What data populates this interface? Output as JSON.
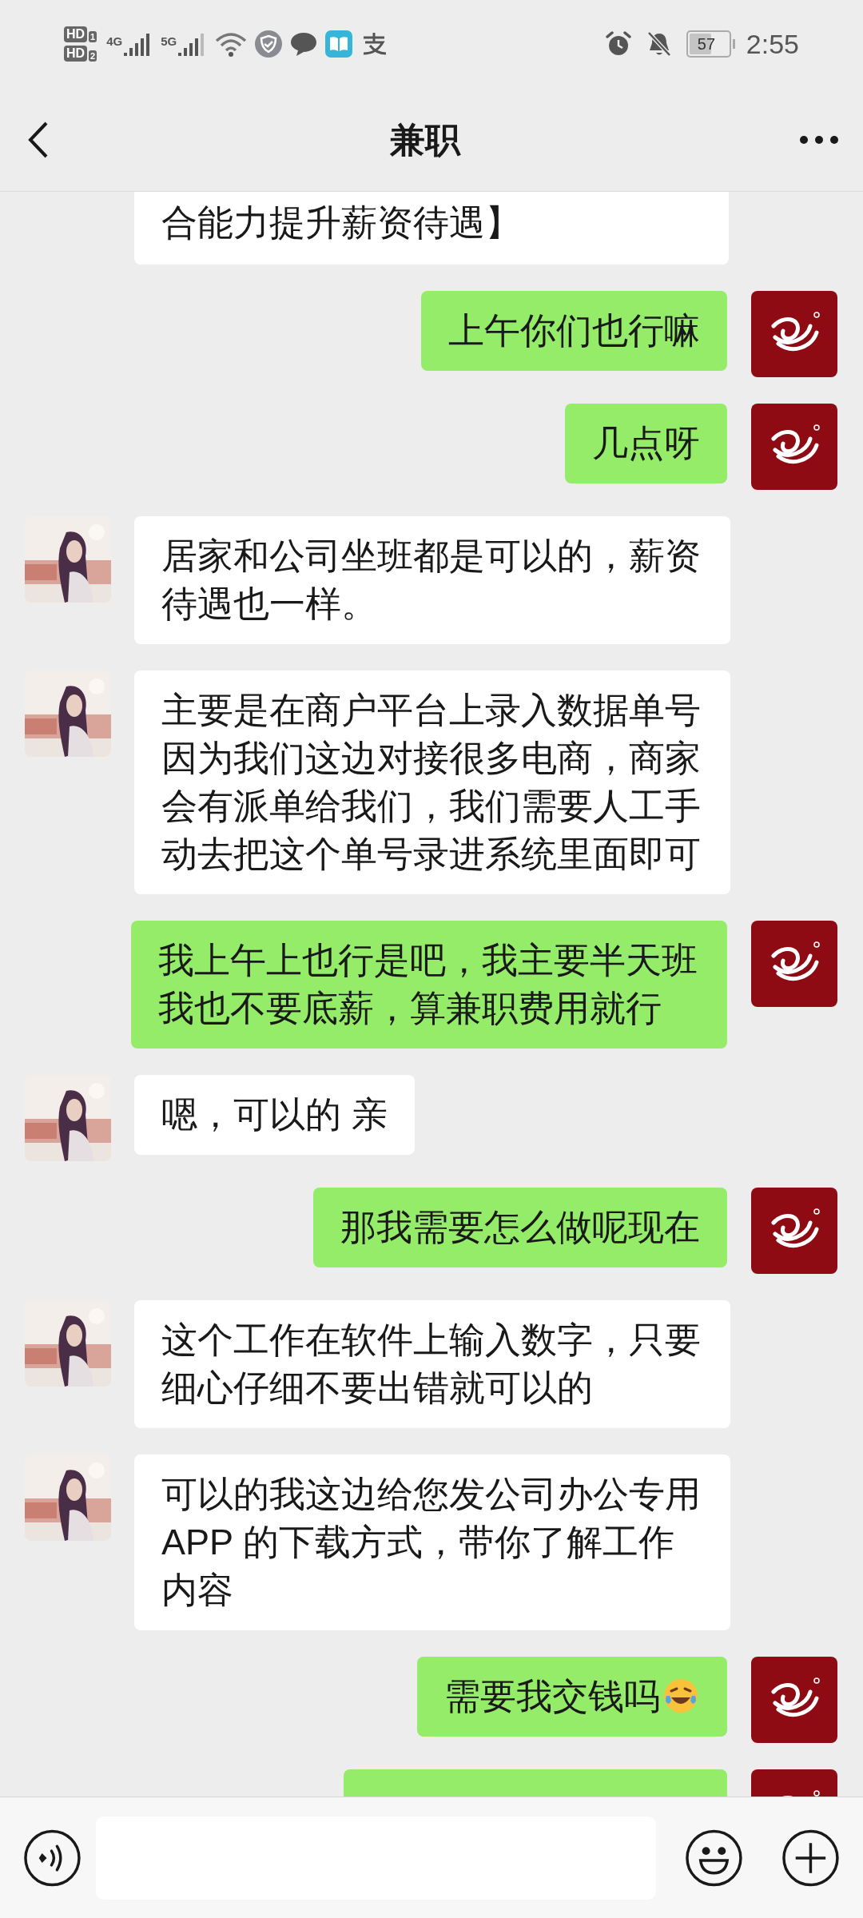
{
  "status_bar": {
    "hd_badges": [
      {
        "label": "HD",
        "slot": "1"
      },
      {
        "label": "HD",
        "slot": "2"
      }
    ],
    "networks": [
      "4G",
      "5G"
    ],
    "battery": "57",
    "time": "2:55"
  },
  "header": {
    "title": "兼职"
  },
  "messages": [
    {
      "outgoing": false,
      "kind": "top_cut",
      "text": "合能力提升薪资待遇】"
    },
    {
      "outgoing": true,
      "kind": "full",
      "text": "上午你们也行嘛"
    },
    {
      "outgoing": true,
      "kind": "full",
      "text": "几点呀"
    },
    {
      "outgoing": false,
      "kind": "full",
      "text": "居家和公司坐班都是可以的，薪资待遇也一样。"
    },
    {
      "outgoing": false,
      "kind": "full",
      "text": "主要是在商户平台上录入数据单号因为我们这边对接很多电商，商家会有派单给我们，我们需要人工手动去把这个单号录进系统里面即可"
    },
    {
      "outgoing": true,
      "kind": "full",
      "text": "我上午上也行是吧，我主要半天班我也不要底薪，算兼职费用就行"
    },
    {
      "outgoing": false,
      "kind": "full",
      "text": "嗯，可以的 亲"
    },
    {
      "outgoing": true,
      "kind": "full",
      "text": "那我需要怎么做呢现在"
    },
    {
      "outgoing": false,
      "kind": "full",
      "text": "这个工作在软件上输入数字，只要细心仔细不要出错就可以的"
    },
    {
      "outgoing": false,
      "kind": "full",
      "text": "可以的我这边给您发公司办公专用APP 的下载方式，带你了解工作内容"
    },
    {
      "outgoing": true,
      "kind": "full",
      "text": "需要我交钱吗",
      "emoji": true
    },
    {
      "outgoing": true,
      "kind": "bottom_cut"
    }
  ]
}
